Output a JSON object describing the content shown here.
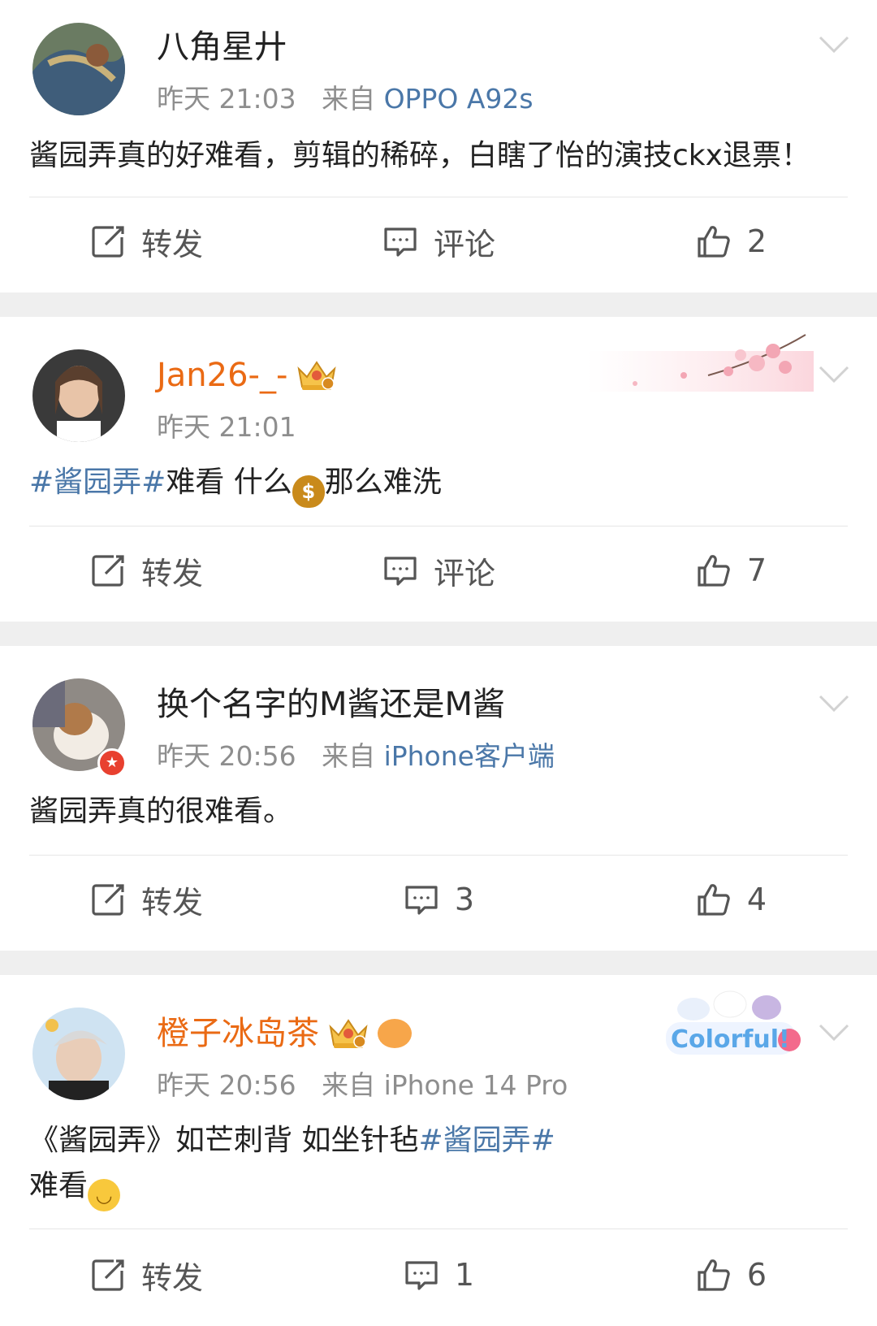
{
  "posts": [
    {
      "name": "八角星廾",
      "time": "昨天 21:03",
      "source_prefix": "来自",
      "source": "OPPO A92s",
      "content": "酱园弄真的好难看，剪辑的稀碎，白瞎了怡的演技ckx退票！",
      "repost_label": "转发",
      "comment_label": "评论",
      "likes": "2"
    },
    {
      "name": "Jan26-_-",
      "time": "昨天 21:01",
      "content_topic": "#酱园弄#",
      "content_a": "难看 什么",
      "content_b": "那么难洗",
      "repost_label": "转发",
      "comment_label": "评论",
      "likes": "7"
    },
    {
      "name": "换个名字的M酱还是M酱",
      "time": "昨天 20:56",
      "source_prefix": "来自",
      "source": "iPhone客户端",
      "content": "酱园弄真的很难看。",
      "repost_label": "转发",
      "comments": "3",
      "likes": "4"
    },
    {
      "name": "橙子冰岛茶",
      "time": "昨天 20:56",
      "source_prefix": "来自",
      "source": "iPhone 14 Pro",
      "content_a": "《酱园弄》如芒刺背 如坐针毡",
      "content_topic": "#酱园弄#",
      "content_b": "难看",
      "badge_text": "Colorful!",
      "repost_label": "转发",
      "comments": "1",
      "likes": "6"
    }
  ],
  "colors": {
    "vip_name": "#ea6a14",
    "link": "#4a77a8",
    "meta": "#8e8e8e"
  },
  "icons": [
    "repost-icon",
    "comment-icon",
    "like-icon",
    "chevron-down-icon",
    "crown-icon",
    "money-bag-emoji",
    "smile-emoji"
  ]
}
